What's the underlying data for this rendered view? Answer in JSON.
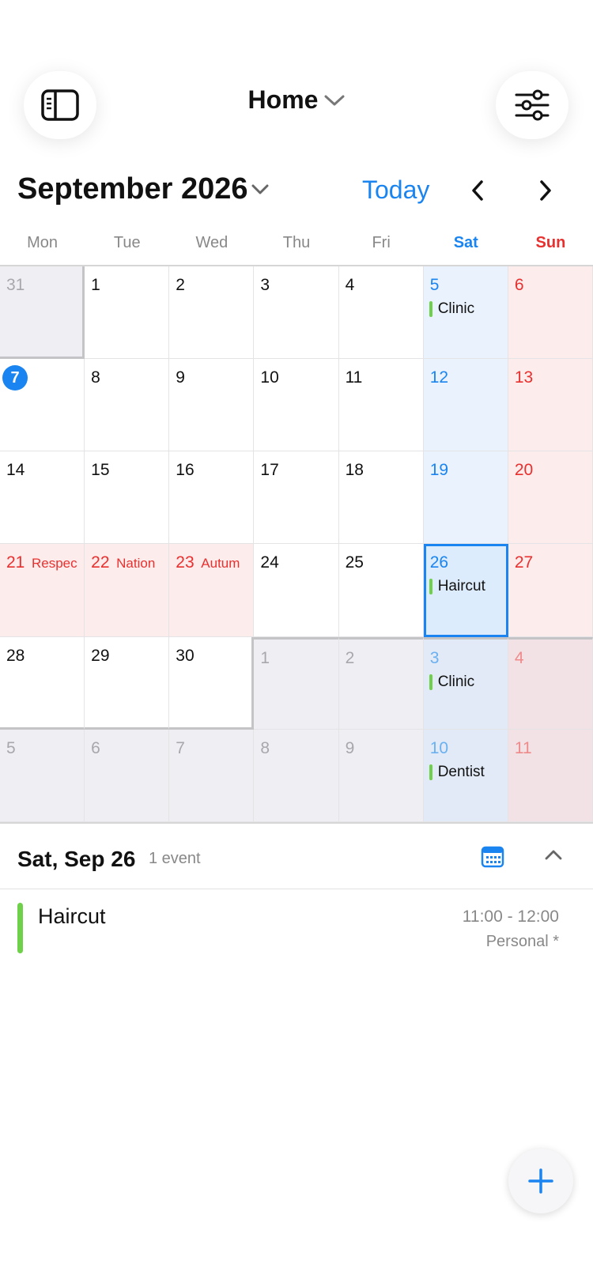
{
  "header": {
    "title": "Home",
    "sidebar_icon": "sidebar-icon",
    "filter_icon": "sliders-icon"
  },
  "month_bar": {
    "label": "September 2026",
    "today_label": "Today"
  },
  "weekdays": [
    "Mon",
    "Tue",
    "Wed",
    "Thu",
    "Fri",
    "Sat",
    "Sun"
  ],
  "weeks": [
    [
      {
        "day": "31",
        "out": true
      },
      {
        "day": "1"
      },
      {
        "day": "2"
      },
      {
        "day": "3"
      },
      {
        "day": "4"
      },
      {
        "day": "5",
        "event": "Clinic"
      },
      {
        "day": "6"
      }
    ],
    [
      {
        "day": "7",
        "today": true
      },
      {
        "day": "8"
      },
      {
        "day": "9"
      },
      {
        "day": "10"
      },
      {
        "day": "11"
      },
      {
        "day": "12"
      },
      {
        "day": "13"
      }
    ],
    [
      {
        "day": "14"
      },
      {
        "day": "15"
      },
      {
        "day": "16"
      },
      {
        "day": "17"
      },
      {
        "day": "18"
      },
      {
        "day": "19"
      },
      {
        "day": "20"
      }
    ],
    [
      {
        "day": "21",
        "holiday": "Respec"
      },
      {
        "day": "22",
        "holiday": "Nation"
      },
      {
        "day": "23",
        "holiday": "Autum"
      },
      {
        "day": "24"
      },
      {
        "day": "25"
      },
      {
        "day": "26",
        "event": "Haircut",
        "selected": true
      },
      {
        "day": "27"
      }
    ],
    [
      {
        "day": "28"
      },
      {
        "day": "29"
      },
      {
        "day": "30"
      },
      {
        "day": "1",
        "out": true
      },
      {
        "day": "2",
        "out": true
      },
      {
        "day": "3",
        "out": true,
        "event": "Clinic"
      },
      {
        "day": "4",
        "out": true
      }
    ],
    [
      {
        "day": "5",
        "out": true
      },
      {
        "day": "6",
        "out": true
      },
      {
        "day": "7",
        "out": true
      },
      {
        "day": "8",
        "out": true
      },
      {
        "day": "9",
        "out": true
      },
      {
        "day": "10",
        "out": true,
        "event": "Dentist"
      },
      {
        "day": "11",
        "out": true
      }
    ]
  ],
  "detail": {
    "date": "Sat, Sep 26",
    "count": "1 event",
    "events": [
      {
        "title": "Haircut",
        "time": "11:00 - 12:00",
        "calendar": "Personal *",
        "color": "#6fd14a"
      }
    ]
  },
  "colors": {
    "accent": "#1a84f0",
    "sunday": "#e8312f",
    "event_green": "#6fd14a"
  }
}
